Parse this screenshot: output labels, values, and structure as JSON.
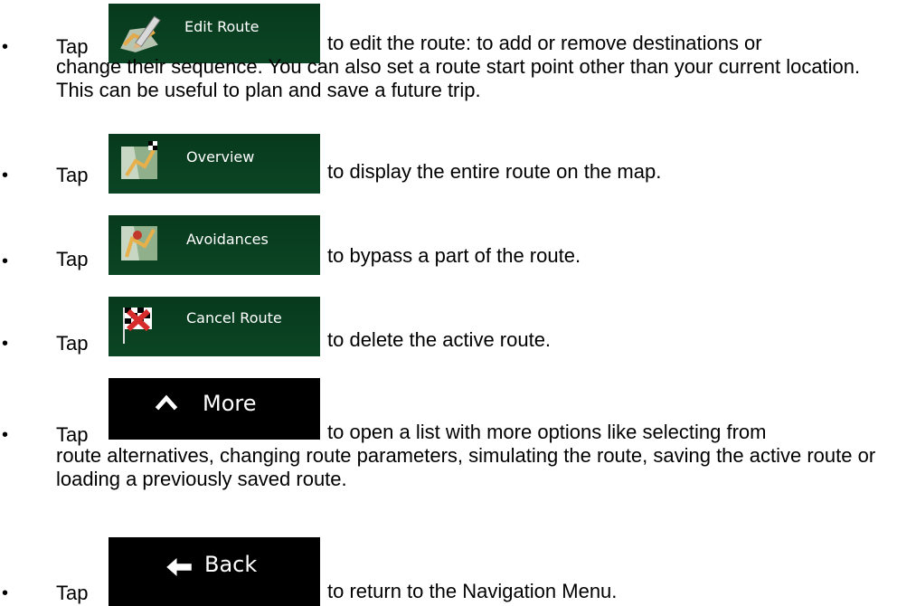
{
  "items": [
    {
      "tap": "Tap",
      "button_label": "Edit Route",
      "icon": "edit-route-icon",
      "desc_first": "to edit the route: to add or remove destinations or",
      "desc_rest": "change their sequence. You can also set a route start point other than your current location. This can be useful to plan and save a future trip."
    },
    {
      "tap": "Tap",
      "button_label": "Overview",
      "icon": "overview-map-icon",
      "desc_first": "to display the entire route on the map."
    },
    {
      "tap": "Tap",
      "button_label": "Avoidances",
      "icon": "avoidances-map-icon",
      "desc_first": "to bypass a part of the route."
    },
    {
      "tap": "Tap",
      "button_label": "Cancel Route",
      "icon": "cancel-route-icon",
      "desc_first": "to delete the active route."
    },
    {
      "tap": "Tap",
      "button_label": "More",
      "icon": "chevron-up-icon",
      "desc_first": "to open a list with more options like selecting from",
      "desc_rest": "route alternatives, changing route parameters, simulating the route, saving the active route or loading a previously saved route."
    },
    {
      "tap": "Tap",
      "button_label": "Back",
      "icon": "arrow-left-icon",
      "desc_first": "to return to the Navigation Menu."
    }
  ],
  "colors": {
    "button_green": "#0a4524",
    "button_dark": "#000000",
    "text": "#000000"
  }
}
